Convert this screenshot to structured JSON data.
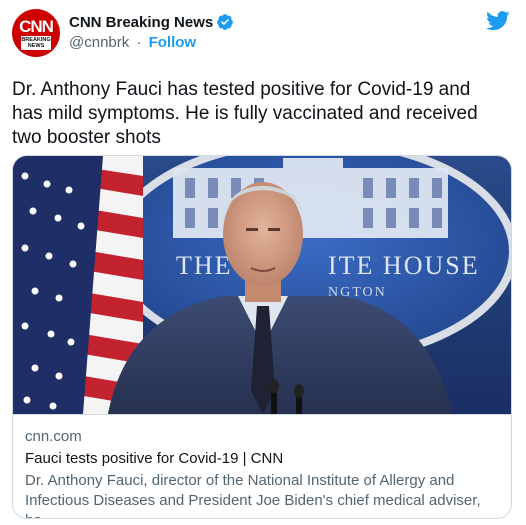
{
  "author": {
    "display_name": "CNN Breaking News",
    "handle": "@cnnbrk",
    "separator": "·",
    "follow_label": "Follow",
    "avatar_logo": "CNN",
    "avatar_tag": "BREAKING NEWS"
  },
  "tweet": {
    "text": "Dr. Anthony Fauci has tested positive for Covid-19 and has mild symptoms. He is fully vaccinated and received two booster shots"
  },
  "card": {
    "domain": "cnn.com",
    "title": "Fauci tests positive for Covid-19 | CNN",
    "description": "Dr. Anthony Fauci, director of the National Institute of Allergy and Infectious Diseases and President Joe Biden's chief medical adviser, ha...",
    "image_sign_text": "THE WHITE HOUSE",
    "image_sign_text_visible_left": "THE",
    "image_sign_text_visible_right": "ITE HOUSE",
    "image_sign_sub": "NGTON"
  },
  "colors": {
    "brand_blue": "#1d9bf0",
    "cnn_red": "#cc0000",
    "text_primary": "#0f1419",
    "text_secondary": "#536471",
    "border": "#cfd9de"
  },
  "icons": {
    "verified": "verified-badge-icon",
    "platform": "twitter-bird-icon"
  }
}
